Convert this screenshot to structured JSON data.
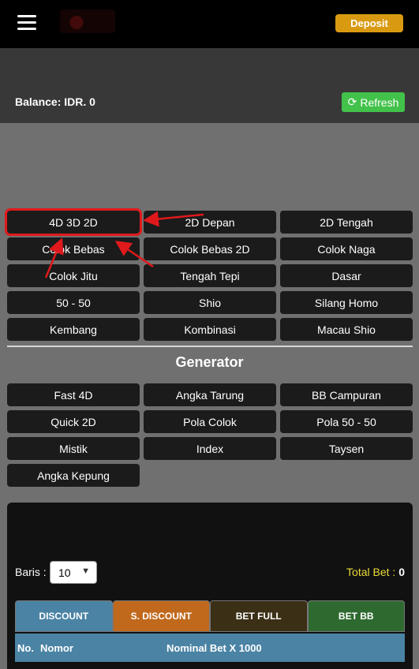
{
  "header": {
    "deposit_label": "Deposit"
  },
  "balance": {
    "label": "Balance: IDR. 0",
    "refresh_label": "Refresh"
  },
  "games": [
    "4D 3D 2D",
    "2D Depan",
    "2D Tengah",
    "Colok Bebas",
    "Colok Bebas 2D",
    "Colok Naga",
    "Colok Jitu",
    "Tengah Tepi",
    "Dasar",
    "50 - 50",
    "Shio",
    "Silang Homo",
    "Kembang",
    "Kombinasi",
    "Macau Shio"
  ],
  "generator": {
    "title": "Generator",
    "items": [
      "Fast 4D",
      "Angka Tarung",
      "BB Campuran",
      "Quick 2D",
      "Pola Colok",
      "Pola 50 - 50",
      "Mistik",
      "Index",
      "Taysen",
      "Angka Kepung"
    ]
  },
  "bet": {
    "baris_label": "Baris :",
    "baris_value": "10",
    "total_label": "Total Bet : ",
    "total_value": "0",
    "tabs": [
      {
        "label": "DISCOUNT",
        "color": "#4a83a4"
      },
      {
        "label": "S. DISCOUNT",
        "color": "#c0691d"
      },
      {
        "label": "BET FULL",
        "color": "#3b2f16"
      },
      {
        "label": "BET BB",
        "color": "#2e6a30"
      }
    ],
    "columns": [
      "No.",
      "Nomor",
      "Nominal Bet X 1000"
    ]
  },
  "colors": {
    "selected_outline": "#e0191c",
    "arrow": "#e0191c"
  }
}
